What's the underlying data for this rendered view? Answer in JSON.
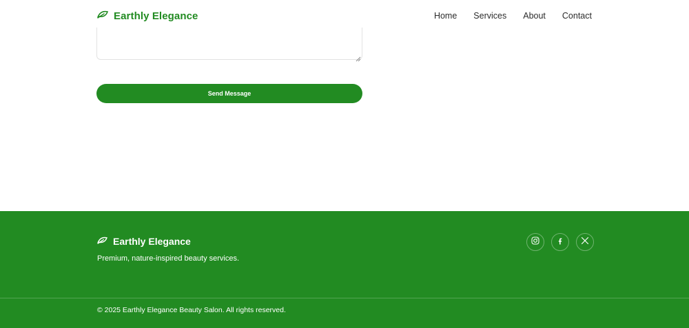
{
  "header": {
    "brand_name": "Earthly Elegance",
    "brand_icon": "leaf-icon",
    "nav": [
      {
        "label": "Home"
      },
      {
        "label": "Services"
      },
      {
        "label": "About"
      },
      {
        "label": "Contact"
      }
    ]
  },
  "form": {
    "message_value": "",
    "submit_label": "Send Message"
  },
  "footer": {
    "brand_name": "Earthly Elegance",
    "tagline": "Premium, nature-inspired beauty services.",
    "socials": [
      {
        "icon": "instagram-icon"
      },
      {
        "icon": "facebook-icon"
      },
      {
        "icon": "x-twitter-icon"
      }
    ],
    "copyright": "© 2025 Earthly Elegance Beauty Salon. All rights reserved."
  },
  "colors": {
    "brand_green": "#228b22",
    "background": "#ffffff",
    "text_dark": "#2b2b2b"
  }
}
